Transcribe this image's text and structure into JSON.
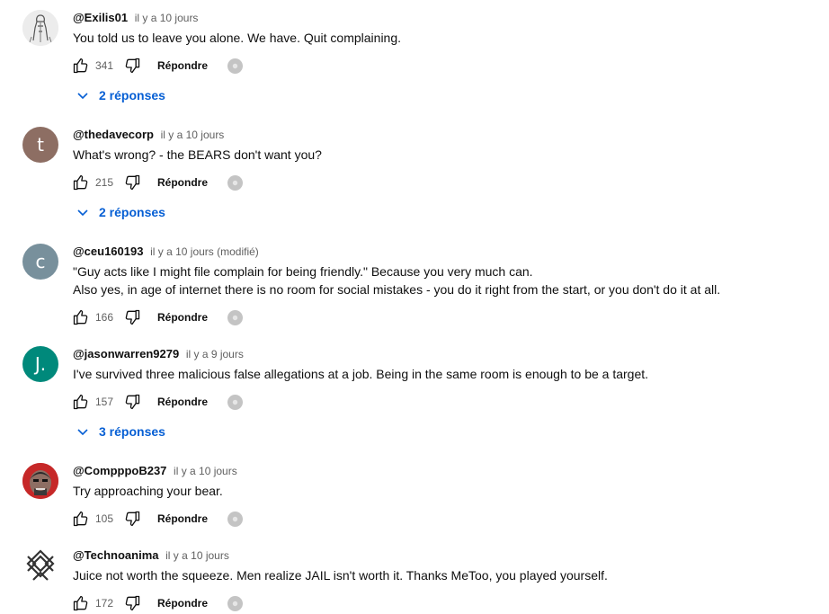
{
  "comments": [
    {
      "author": "@Exilis01",
      "time": "il y a 10 jours",
      "lines": [
        "You told us to leave you alone. We have. Quit complaining."
      ],
      "likes": "341",
      "reply_label": "Répondre",
      "replies_label": "2 réponses",
      "avatar": {
        "type": "image",
        "icon": "sketch-figure-avatar",
        "bg": "#e8e8e8"
      }
    },
    {
      "author": "@thedavecorp",
      "time": "il y a 10 jours",
      "lines": [
        "What's wrong? - the BEARS don't want you?"
      ],
      "likes": "215",
      "reply_label": "Répondre",
      "replies_label": "2 réponses",
      "avatar": {
        "type": "letter",
        "letter": "t",
        "bg": "#8d6e63"
      }
    },
    {
      "author": "@ceu160193",
      "time": "il y a 10 jours (modifié)",
      "lines": [
        "\"Guy acts like I might file complain for being friendly.\" Because you very much can.",
        "Also yes, in age of internet there is no room for social mistakes - you do it right from the start, or you don't do it at all."
      ],
      "likes": "166",
      "reply_label": "Répondre",
      "avatar": {
        "type": "letter",
        "letter": "c",
        "bg": "#78909c"
      }
    },
    {
      "author": "@jasonwarren9279",
      "time": "il y a 9 jours",
      "lines": [
        "I've survived three malicious false allegations at a job. Being in the same room is enough to be a target."
      ],
      "likes": "157",
      "reply_label": "Répondre",
      "replies_label": "3 réponses",
      "avatar": {
        "type": "letter",
        "letter": "J.",
        "bg": "#00897b"
      }
    },
    {
      "author": "@ComppроB237",
      "time": "il y a 10 jours",
      "lines": [
        "Try approaching your bear."
      ],
      "likes": "105",
      "reply_label": "Répondre",
      "avatar": {
        "type": "image",
        "icon": "cartoon-face-avatar",
        "bg": "#c62828"
      }
    },
    {
      "author": "@Technoanima",
      "time": "il y a 10 jours",
      "lines": [
        "Juice not worth the squeeze. Men realize JAIL isn't worth it. Thanks MeToo, you played yourself."
      ],
      "likes": "172",
      "reply_label": "Répondre",
      "avatar": {
        "type": "image",
        "icon": "geometric-pattern-avatar",
        "bg": "#ffffff"
      }
    }
  ],
  "colors": {
    "link": "#065fd4",
    "meta": "#606060",
    "text": "#0f0f0f"
  }
}
